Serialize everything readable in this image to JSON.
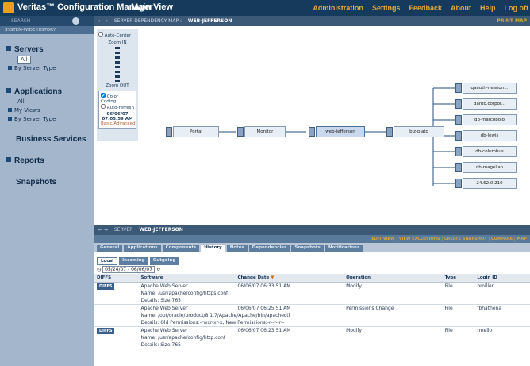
{
  "topbar": {
    "app_title": "Veritas™ Configuration Manager",
    "view": "Main View",
    "nav": [
      "Administration",
      "Settings",
      "Feedback",
      "About",
      "Help",
      "Log off"
    ]
  },
  "sidebar": {
    "search": "SEARCH",
    "history": "SYSTEM-WIDE HISTORY",
    "servers": {
      "label": "Servers",
      "items": [
        "All",
        "By Server Type"
      ]
    },
    "applications": {
      "label": "Applications",
      "items": [
        "All",
        "My Views",
        "By Server Type"
      ]
    },
    "business": "Business Services",
    "reports": "Reports",
    "snapshots": "Snapshots"
  },
  "map": {
    "crumb": "SERVER DEPENDENCY MAP :",
    "name": "WEB-JEFFERSON",
    "print": "PRINT MAP",
    "auto_center": "Auto-Center",
    "zoom_in": "Zoom IN",
    "zoom_out": "Zoom OUT",
    "color_coding": "Color Coding",
    "auto_refresh": "Auto-refresh",
    "date": "06/06/07",
    "time": "07:05:59 AM",
    "legend": "Basic/Advanced",
    "chain": [
      "Portal",
      "Monitor",
      "web-jefferson",
      "biz-plato"
    ],
    "targets": [
      "qaauth-newton...",
      "danto.corpor...",
      "db-marcopolo",
      "db-lewis",
      "db-columbus",
      "db-magellan",
      "24.62.0.210"
    ]
  },
  "server": {
    "crumb": "SERVER",
    "name": "WEB-JEFFERSON",
    "actions": [
      "EDIT VIEW",
      "VIEW EXCLUSIONS",
      "CREATE SNAPSHOT",
      "COMPARE",
      "MAP"
    ],
    "tabs": [
      "General",
      "Applications",
      "Components",
      "History",
      "Notes",
      "Dependencies",
      "Snapshots",
      "Notifications"
    ],
    "subtabs": [
      "Local",
      "Incoming",
      "Outgoing"
    ],
    "daterange": "05/24/07 - 06/06/07",
    "cols": [
      "DIFFS",
      "Software",
      "Change Date",
      "Operation",
      "Type",
      "Login ID"
    ],
    "rows": [
      {
        "diff": "DIFFS",
        "sw": "Apache Web Server",
        "date": "06/06/07 06:33:51 AM",
        "op": "Modify",
        "type": "File",
        "login": "bmiller",
        "l1": "Name:  /usr/apache/config/https.conf",
        "l2": "Details:  Size:765"
      },
      {
        "diff": "",
        "sw": "Apache Web Server",
        "date": "06/06/07 06:25:51 AM",
        "op": "Permissions Change",
        "type": "File",
        "login": "fbhathena",
        "l1": "Name:  /opt/oracle/product/8.1.7/Apache/Apache/bin/apachectl",
        "l2": "Details:  Old Permissions:-rwxr-xr-x, New Permissions:-r--r--r--"
      },
      {
        "diff": "DIFFS",
        "sw": "Apache Web Server",
        "date": "06/06/07 06:23:51 AM",
        "op": "Modify",
        "type": "File",
        "login": "rmello",
        "l1": "Name:  /usr/apache/config/http.conf",
        "l2": "Details:  Size:765"
      }
    ]
  }
}
